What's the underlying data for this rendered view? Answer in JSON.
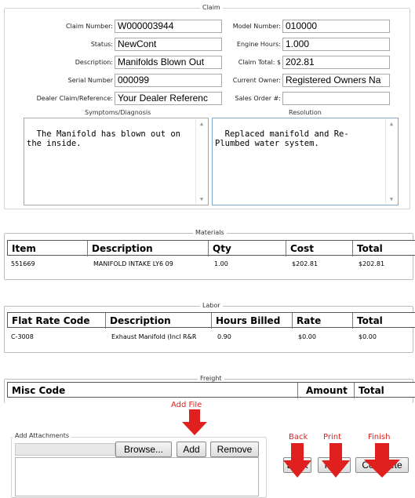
{
  "claim": {
    "legend": "Claim",
    "claim_number": {
      "label": "Claim Number:",
      "value": "W000003944"
    },
    "status": {
      "label": "Status:",
      "value": "NewCont"
    },
    "description": {
      "label": "Description:",
      "value": "Manifolds Blown Out"
    },
    "serial_number": {
      "label": "Serial Number",
      "value": "000099"
    },
    "dealer_claim": {
      "label": "Dealer Claim/Reference:",
      "value": "Your Dealer Referenc"
    },
    "model_number": {
      "label": "Model Number:",
      "value": "010000"
    },
    "engine_hours": {
      "label": "Engine Hours:",
      "value": "1.000"
    },
    "claim_total": {
      "label": "Claim Total: $",
      "value": "202.81"
    },
    "current_owner": {
      "label": "Current Owner:",
      "value": "Registered Owners Na"
    },
    "sales_order": {
      "label": "Sales Order #:",
      "value": ""
    },
    "symptoms": {
      "label": "Symptoms/Diagnosis",
      "value": "The Manifold has blown out on\nthe inside."
    },
    "resolution": {
      "label": "Resolution",
      "value": "Replaced manifold and Re-\nPlumbed water system."
    }
  },
  "materials": {
    "legend": "Materials",
    "headers": [
      "Item",
      "Description",
      "Qty",
      "Cost",
      "Total"
    ],
    "rows": [
      {
        "item": "551669",
        "description": "MANIFOLD INTAKE LY6 09",
        "qty": "1.00",
        "cost": "$202.81",
        "total": "$202.81"
      }
    ]
  },
  "labor": {
    "legend": "Labor",
    "headers": [
      "Flat Rate Code",
      "Description",
      "Hours Billed",
      "Rate",
      "Total"
    ],
    "rows": [
      {
        "code": "C-3008",
        "description": "Exhaust Manifold (Incl R&R",
        "hours": "0.90",
        "rate": "$0.00",
        "total": "$0.00"
      }
    ]
  },
  "freight": {
    "legend": "Freight",
    "headers": [
      "Misc Code",
      "Amount",
      "Total"
    ]
  },
  "attachments": {
    "legend": "Add Attachments",
    "browse_label": "Browse...",
    "add_label": "Add",
    "remove_label": "Remove"
  },
  "actions": {
    "back_label": "Back",
    "print_label": "Print",
    "complete_label": "Complete"
  },
  "annotations": {
    "add_file": "Add File",
    "back": "Back",
    "print": "Print",
    "finish": "Finish",
    "color": "#e0201e"
  }
}
